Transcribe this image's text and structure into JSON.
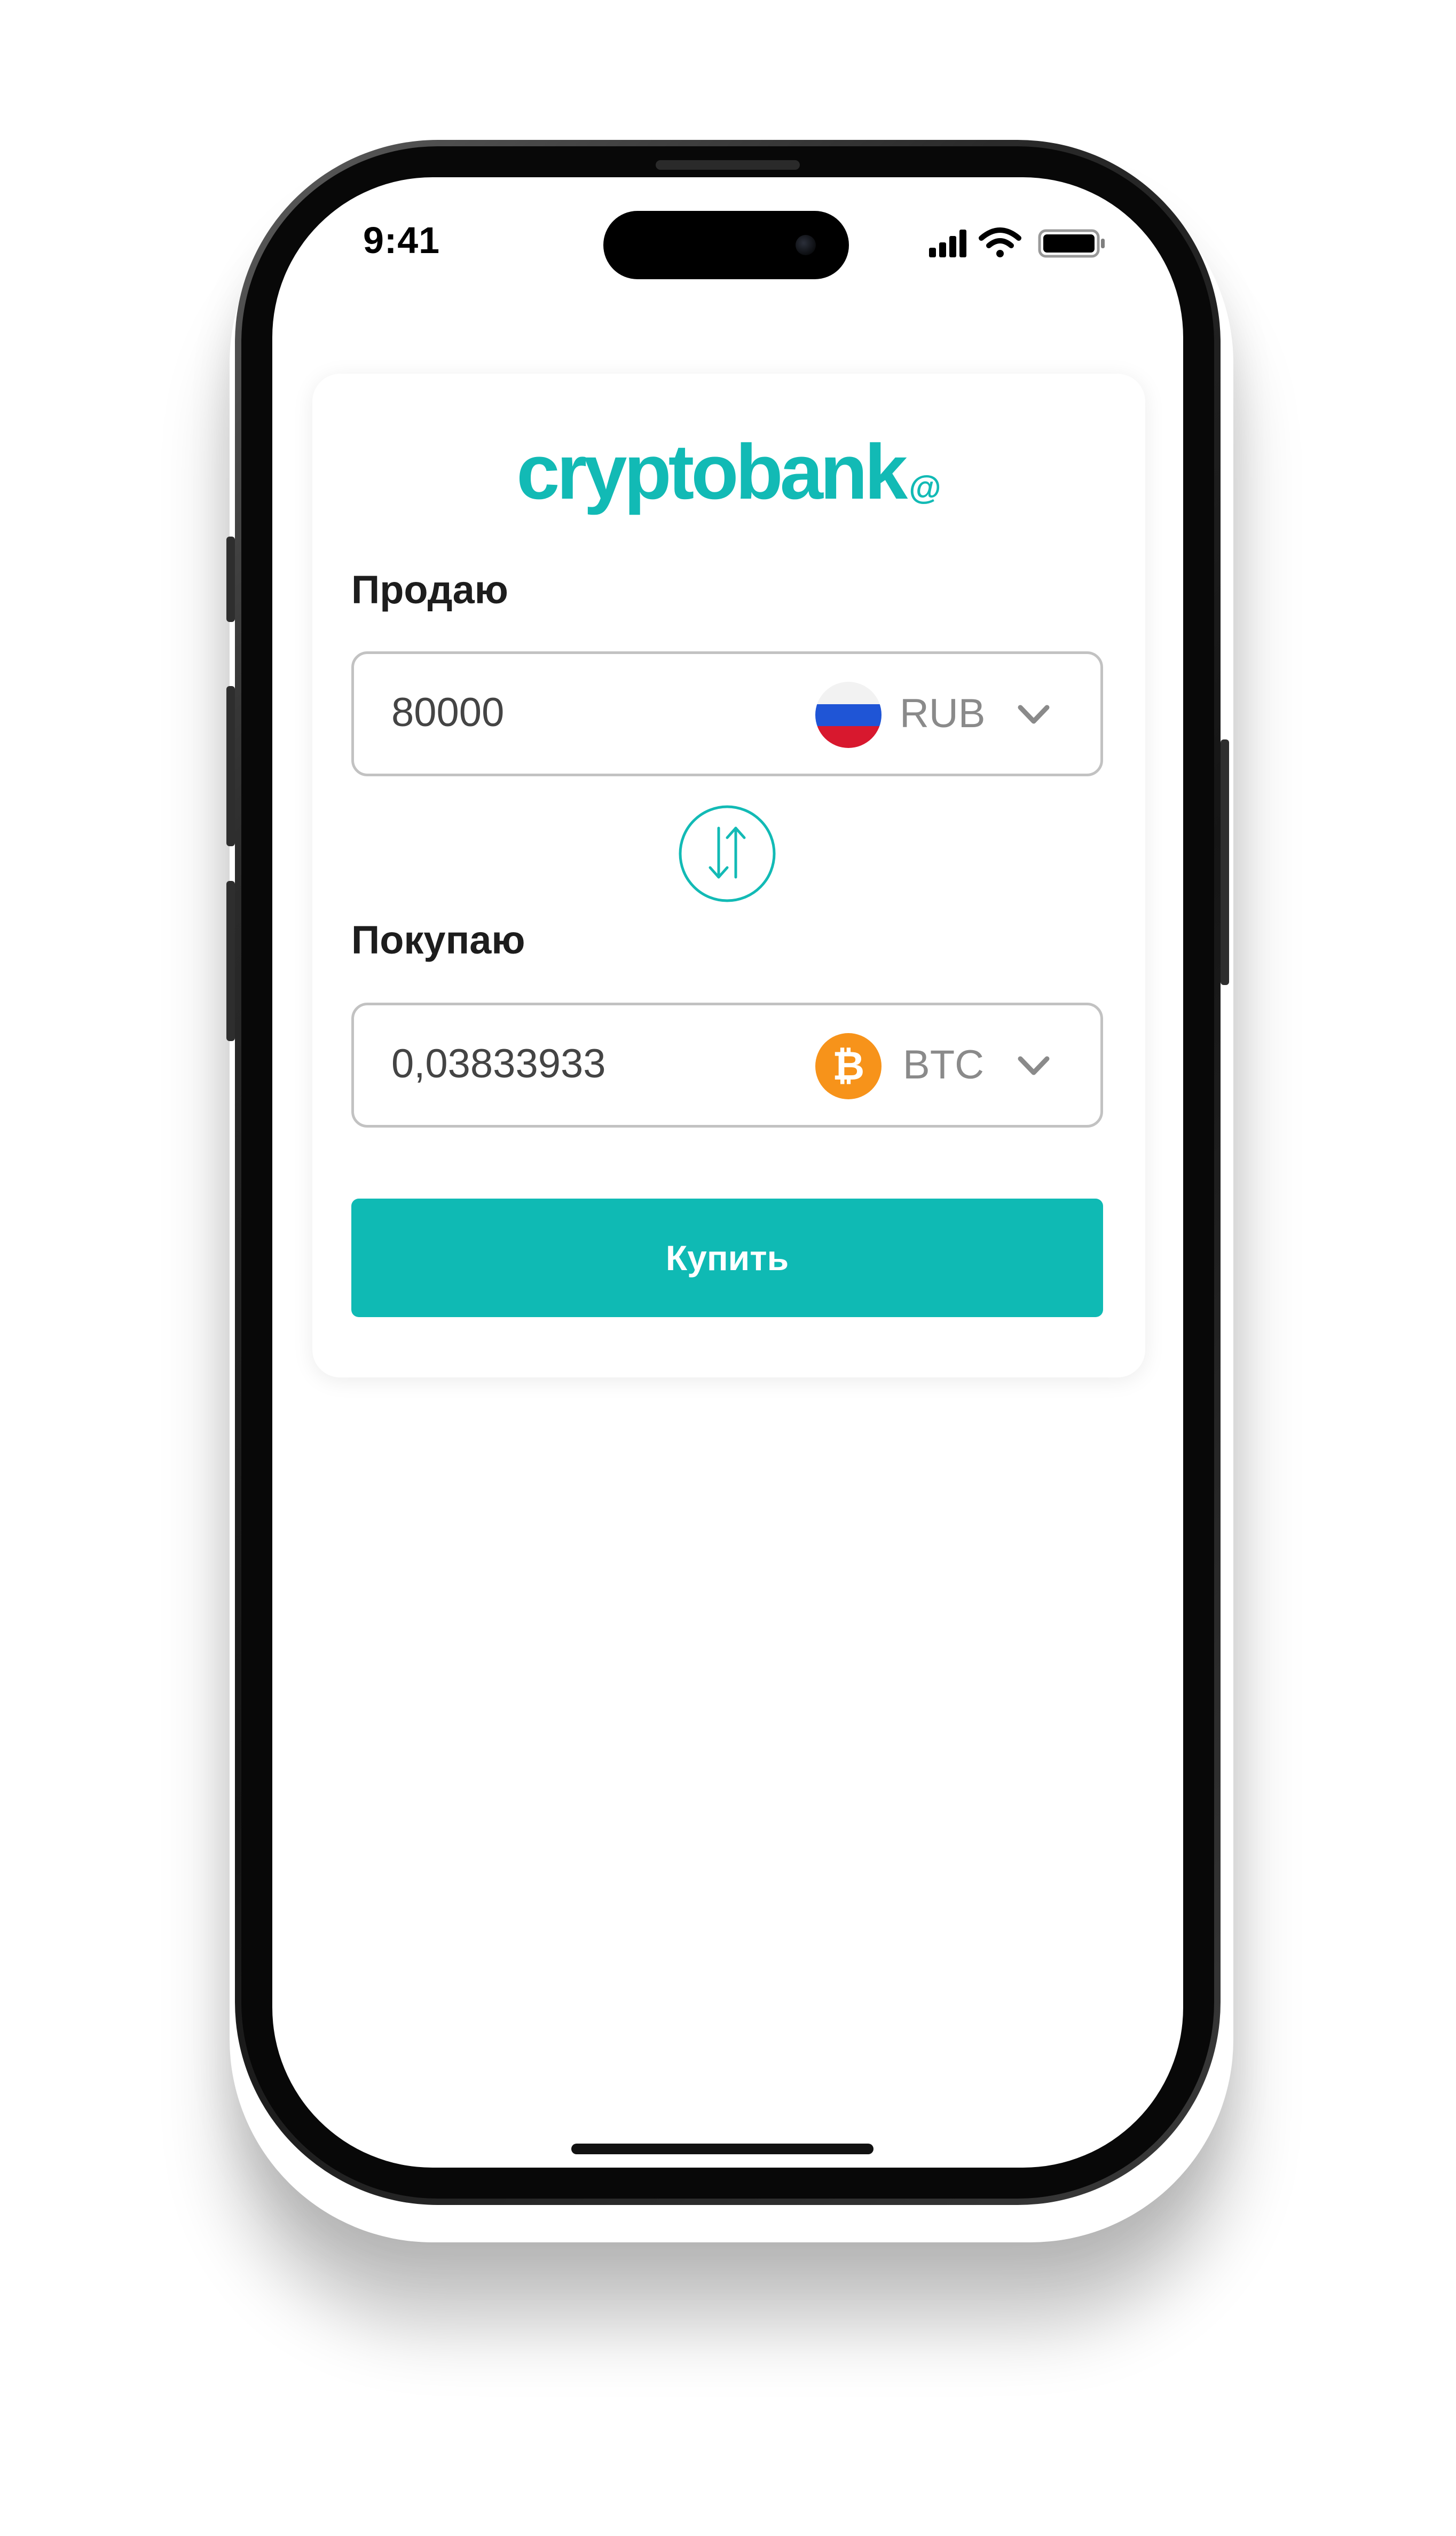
{
  "status_bar": {
    "time": "9:41"
  },
  "logo": {
    "text": "cryptobank",
    "mark": "@"
  },
  "sell": {
    "label": "Продаю",
    "amount": "80000",
    "currency": "RUB",
    "currency_icon": "russia-flag-icon"
  },
  "buy": {
    "label": "Покупаю",
    "amount": "0,03833933",
    "currency": "BTC",
    "currency_icon": "bitcoin-icon"
  },
  "swap_icon": "swap-arrows-icon",
  "action": {
    "buy_label": "Купить"
  },
  "colors": {
    "accent": "#12bab5",
    "button": "#0fbab4",
    "bitcoin": "#f7931a",
    "flag_white": "#f2f2f2",
    "flag_blue": "#1f55d6",
    "flag_red": "#d8182e"
  }
}
